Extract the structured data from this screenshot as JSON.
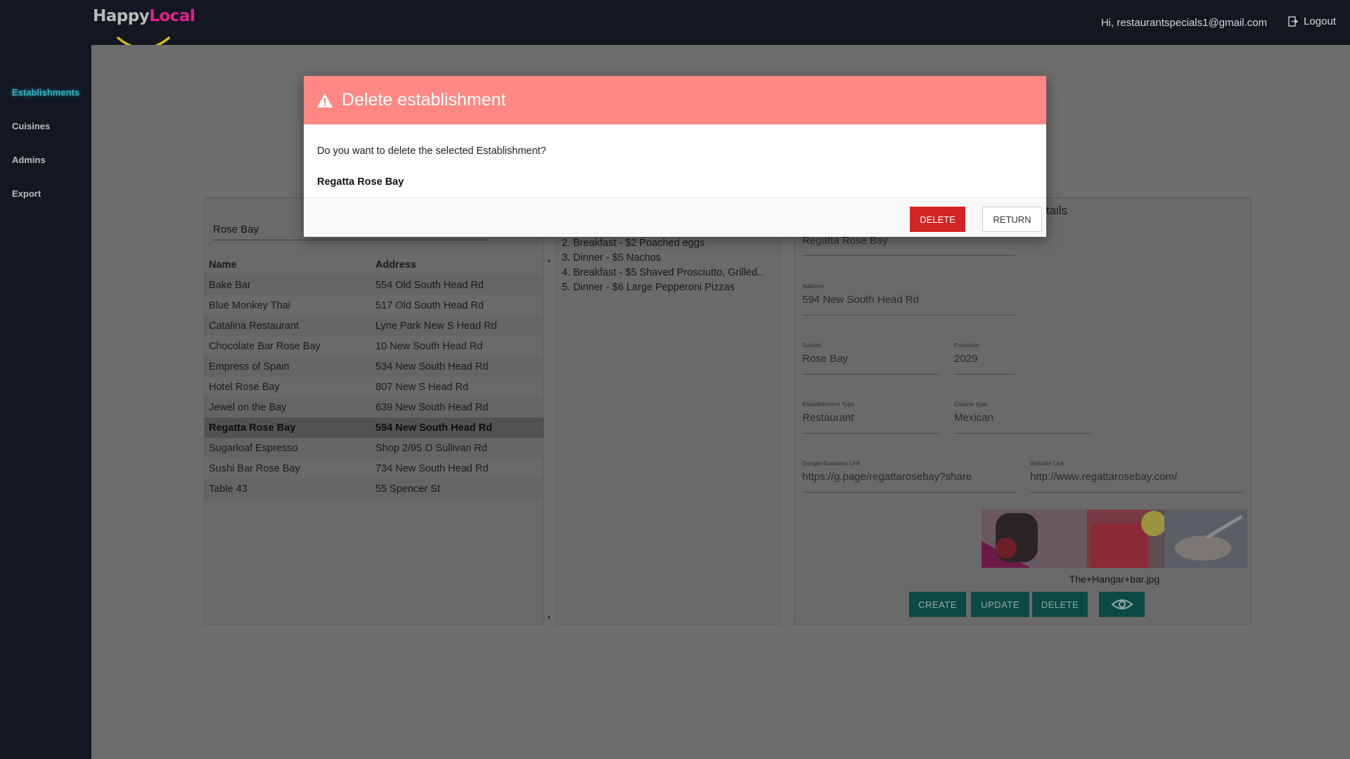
{
  "header": {
    "logo_part1": "Happy",
    "logo_part2": "Local",
    "user_greeting": "Hi, restaurantspecials1@gmail.com",
    "logout_label": "Logout"
  },
  "sidebar": {
    "items": [
      {
        "label": "Establishments",
        "active": true
      },
      {
        "label": "Cuisines",
        "active": false
      },
      {
        "label": "Admins",
        "active": false
      },
      {
        "label": "Export",
        "active": false
      }
    ]
  },
  "establishments": {
    "search_value": "Rose Bay",
    "columns": [
      "Name",
      "Address"
    ],
    "rows": [
      {
        "name": "Bake Bar",
        "address": "554 Old South Head Rd"
      },
      {
        "name": "Blue Monkey Thai",
        "address": "517 Old South Head Rd"
      },
      {
        "name": "Catalina Restaurant",
        "address": "Lyne Park New S Head Rd"
      },
      {
        "name": "Chocolate Bar Rose Bay",
        "address": "10 New South Head Rd"
      },
      {
        "name": "Empress of Spain",
        "address": "534 New South Head Rd"
      },
      {
        "name": "Hotel Rose Bay",
        "address": "807 New S Head Rd"
      },
      {
        "name": "Jewel on the Bay",
        "address": "639 New South Head Rd"
      },
      {
        "name": "Regatta Rose Bay",
        "address": "594 New South Head Rd"
      },
      {
        "name": "Sugarloaf Espresso",
        "address": "Shop 2/95 O Sullivan Rd"
      },
      {
        "name": "Sushi Bar Rose Bay",
        "address": "734 New South Head Rd"
      },
      {
        "name": "Table 43",
        "address": "55 Spencer St"
      }
    ],
    "selected_index": 7
  },
  "specials": {
    "items": [
      "2. Breakfast - $2 Poached eggs",
      "3. Dinner - $5 Nachos",
      "4. Breakfast - $5 Shaved Prosciutto, Grilled..",
      "5. Dinner - $6 Large Pepperoni Pizzas"
    ]
  },
  "details": {
    "title_fragment": "details",
    "name_value": "Regatta Rose Bay",
    "address_label": "Address",
    "address_value": "594 New South Head Rd",
    "suburb_label": "Suburb",
    "suburb_value": "Rose Bay",
    "postcode_label": "Postcode",
    "postcode_value": "2029",
    "type_label": "Establishment Type",
    "type_value": "Restaurant",
    "cuisine_label": "Cuisine type",
    "cuisine_value": "Mexican",
    "google_label": "Google Business Link",
    "google_value": "https://g.page/regattarosebay?share",
    "website_label": "Website Link",
    "website_value": "http://www.regattarosebay.com/",
    "image_caption": "The+Hangar+bar.jpg",
    "buttons": {
      "create": "CREATE",
      "update": "UPDATE",
      "delete": "DELETE"
    }
  },
  "modal": {
    "title": "Delete establishment",
    "message": "Do you want to delete the selected Establishment?",
    "establishment_name": "Regatta Rose Bay",
    "delete_label": "DELETE",
    "return_label": "RETURN",
    "header_color": "#ff8884",
    "delete_color": "#d32424"
  },
  "colors": {
    "accent": "#2fb7c9",
    "brand_pink": "#e0218a",
    "teal_button": "#0b4a44"
  }
}
